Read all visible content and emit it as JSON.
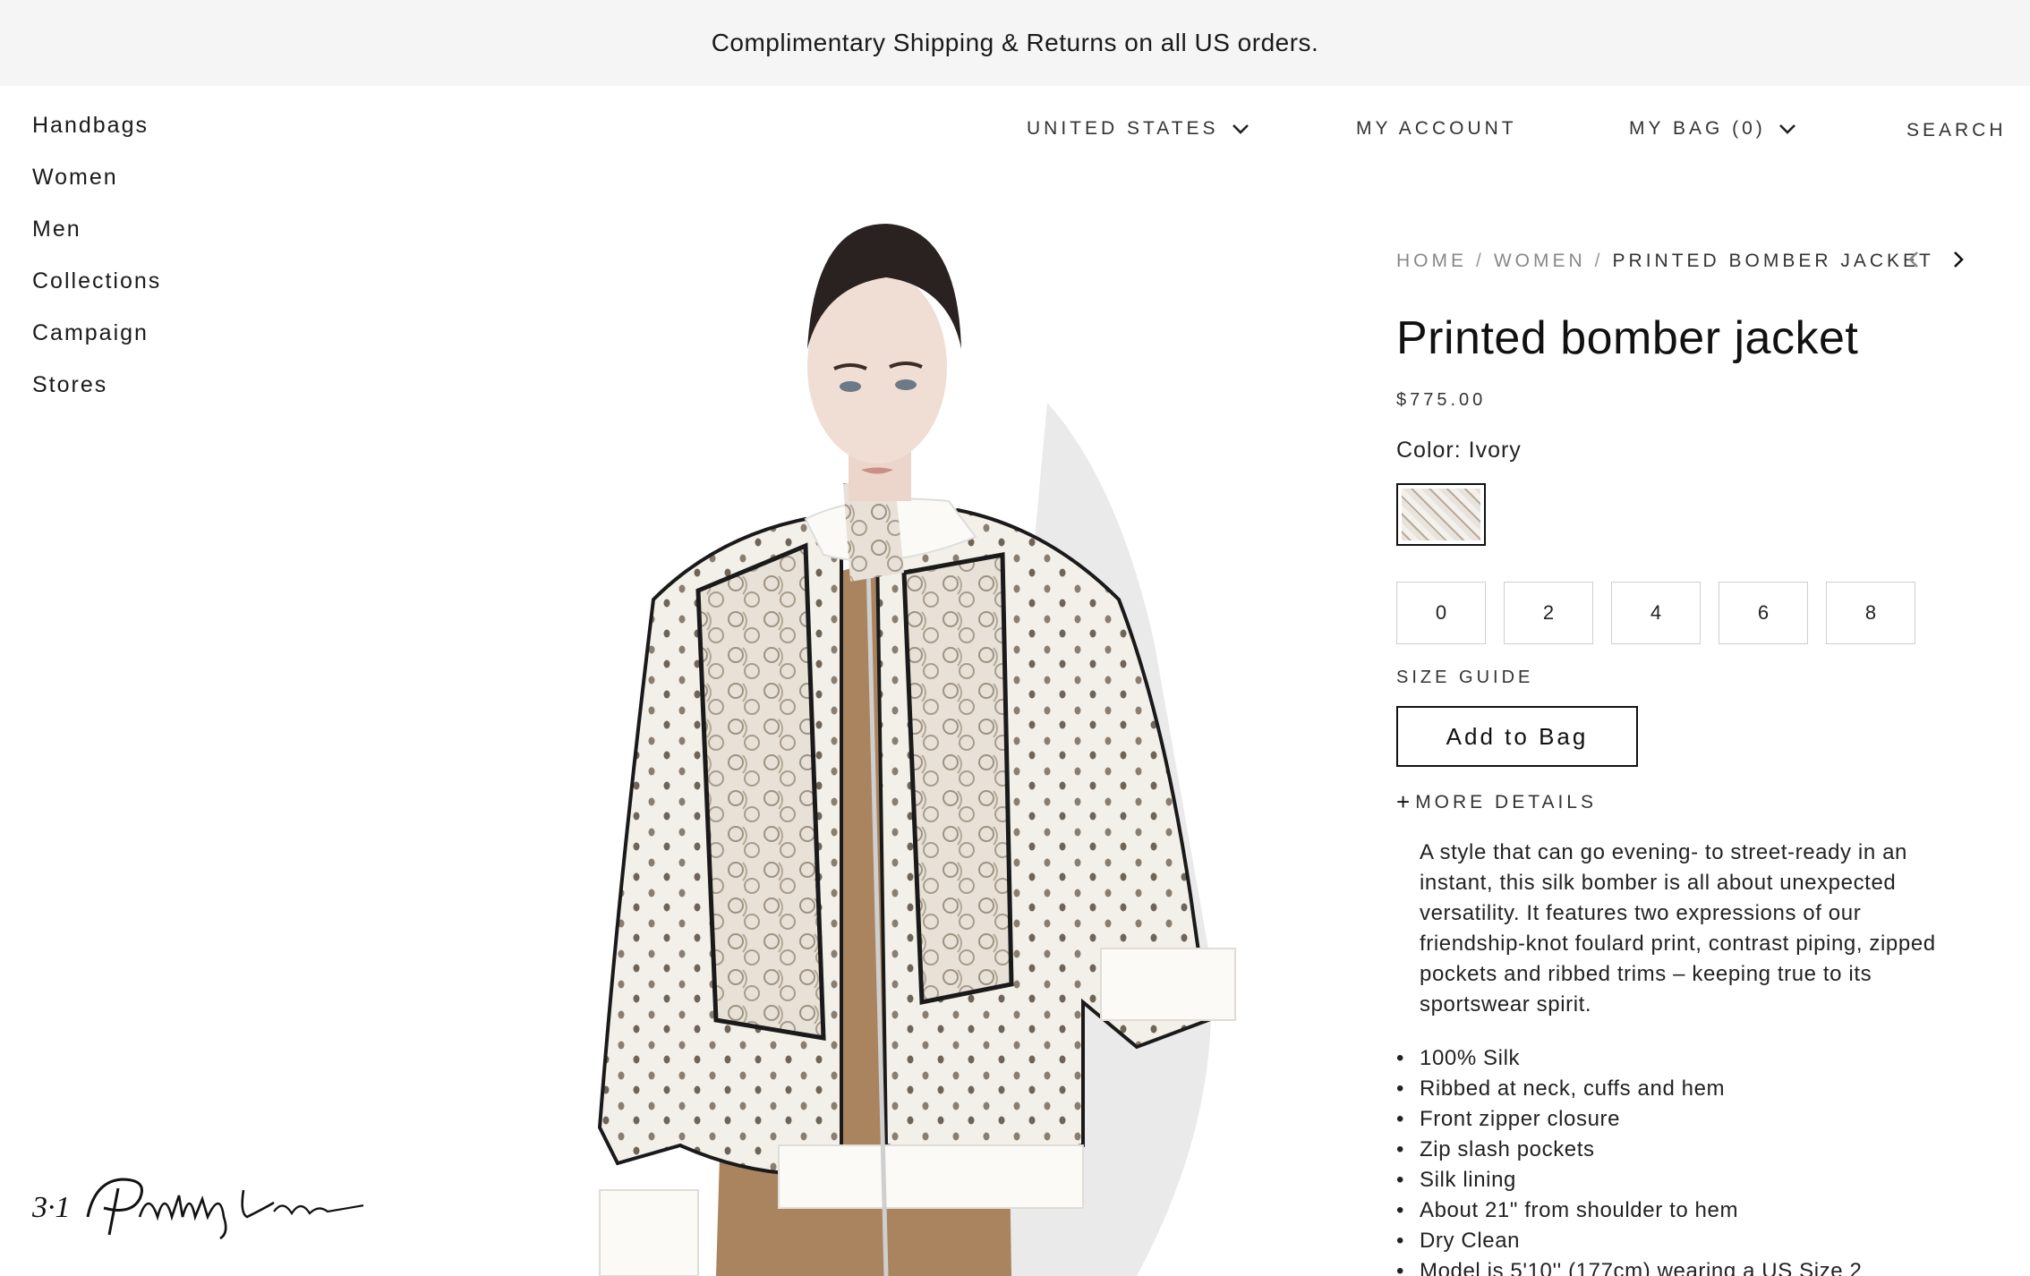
{
  "promo": {
    "text": "Complimentary Shipping & Returns on all US orders."
  },
  "left_nav": {
    "items": [
      "Handbags",
      "Women",
      "Men",
      "Collections",
      "Campaign",
      "Stores"
    ]
  },
  "top_nav": {
    "country": "UNITED STATES",
    "account": "MY ACCOUNT",
    "bag": "MY BAG (0)",
    "search": "SEARCH"
  },
  "breadcrumb": {
    "home": "HOME",
    "women": "WOMEN",
    "current": "PRINTED BOMBER JACKET",
    "separator": "/"
  },
  "product": {
    "title": "Printed bomber jacket",
    "price": "$775.00",
    "color_label": "Color: Ivory",
    "sizes": [
      "0",
      "2",
      "4",
      "6",
      "8"
    ],
    "size_guide": "SIZE GUIDE",
    "add_to_bag": "Add to Bag",
    "more_details": "MORE DETAILS",
    "more_details_icon": "+",
    "description": "A style that can go evening- to street-ready in an instant, this silk bomber is all about unexpected versatility. It features two expressions of our friendship-knot foulard print, contrast piping, zipped pockets and ribbed trims – keeping true to its sportswear spirit.",
    "features": [
      "100% Silk",
      "Ribbed at neck, cuffs and hem",
      "Front zipper closure",
      "Zip slash pockets",
      "Silk lining",
      "About 21\" from shoulder to hem",
      "Dry Clean",
      "Model is 5'10'' (177cm) wearing a US Size 2"
    ]
  },
  "logo": {
    "text": "3.1 Phillip Lim"
  },
  "colors": {
    "promo_bg": "#f5f5f5",
    "text": "#1a1a1a",
    "muted": "#888888",
    "border": "#cfcfcf"
  }
}
